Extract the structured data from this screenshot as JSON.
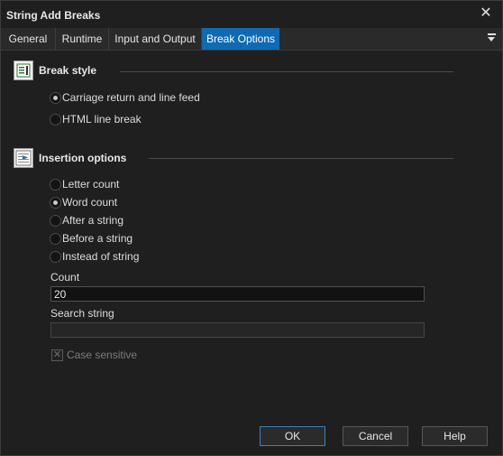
{
  "window": {
    "title": "String Add Breaks",
    "close_glyph": "✕"
  },
  "tabs": [
    {
      "label": "General"
    },
    {
      "label": "Runtime"
    },
    {
      "label": "Input and Output"
    },
    {
      "label": "Break Options",
      "active": true
    }
  ],
  "break_style": {
    "title": "Break style",
    "icon": "document-lines-icon",
    "options": [
      {
        "label": "Carriage return and line feed",
        "checked": true
      },
      {
        "label": "HTML line break",
        "checked": false
      }
    ]
  },
  "insertion": {
    "title": "Insertion options",
    "icon": "insert-arrow-icon",
    "options": [
      {
        "label": "Letter count",
        "checked": false
      },
      {
        "label": "Word count",
        "checked": true
      },
      {
        "label": "After a string",
        "checked": false
      },
      {
        "label": "Before a string",
        "checked": false
      },
      {
        "label": "Instead of string",
        "checked": false
      }
    ],
    "count_label": "Count",
    "count_value": "20",
    "search_label": "Search string",
    "search_value": "",
    "case_label": "Case sensitive",
    "case_glyph": "✕"
  },
  "buttons": {
    "ok": "OK",
    "cancel": "Cancel",
    "help": "Help"
  },
  "colors": {
    "accent": "#0e6ab3",
    "background": "#1f1f1f"
  }
}
